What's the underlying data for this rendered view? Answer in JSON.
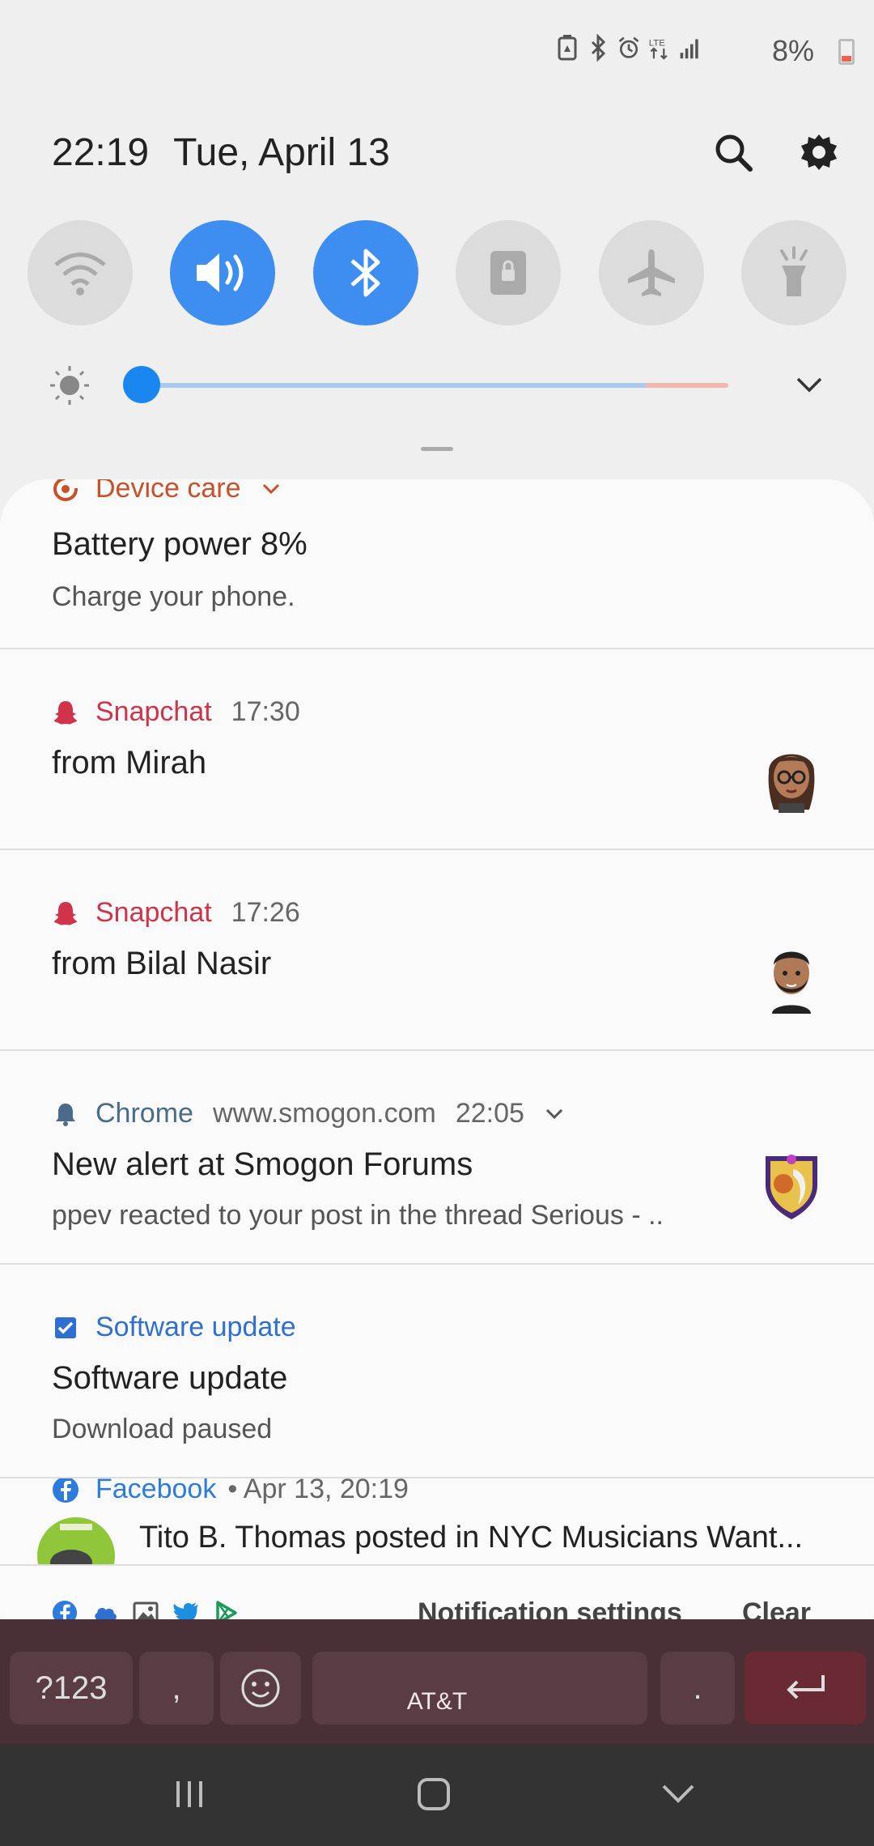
{
  "status": {
    "battery_text": "8%",
    "network": "LTE"
  },
  "header": {
    "time": "22:19",
    "date": "Tue, April 13"
  },
  "toggles": [
    {
      "name": "wifi",
      "on": false
    },
    {
      "name": "sound",
      "on": true
    },
    {
      "name": "bluetooth",
      "on": true
    },
    {
      "name": "screen-lock",
      "on": false
    },
    {
      "name": "airplane",
      "on": false
    },
    {
      "name": "flashlight",
      "on": false
    }
  ],
  "brightness": {
    "level": 0.03
  },
  "notifications": {
    "device_care": {
      "app": "Device care",
      "title": "Battery power 8%",
      "body": "Charge your phone.",
      "color": "#c8502a"
    },
    "snap1": {
      "app": "Snapchat",
      "time": "17:30",
      "title": "from Mirah",
      "color": "#d0334a"
    },
    "snap2": {
      "app": "Snapchat",
      "time": "17:26",
      "title": "from Bilal Nasir",
      "color": "#d0334a"
    },
    "chrome": {
      "app": "Chrome",
      "site": "www.smogon.com",
      "time": "22:05",
      "title": "New alert at Smogon Forums",
      "body": "ppev reacted to your post in the thread Serious - ..",
      "color": "#4a6c8a"
    },
    "software": {
      "app": "Software update",
      "title": "Software update",
      "body": "Download paused",
      "color": "#2e6fd0"
    },
    "facebook": {
      "app": "Facebook",
      "meta": "• Apr 13, 20:19",
      "title": "Tito B. Thomas posted in NYC Musicians Want...",
      "color": "#2e7be0"
    }
  },
  "footer": {
    "settings_label": "Notification settings",
    "clear_label": "Clear"
  },
  "keyboard": {
    "sym_label": "?123",
    "comma_label": ",",
    "period_label": ".",
    "carrier": "AT&T"
  }
}
